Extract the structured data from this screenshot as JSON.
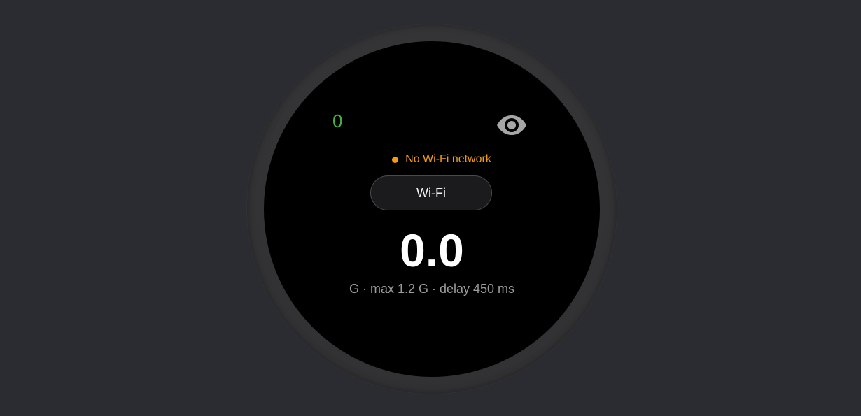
{
  "screen": {
    "counter_value": "0",
    "visibility_icon": "eye-icon",
    "network_status": {
      "text": "No Wi-Fi network",
      "indicator_color": "#f39c12"
    },
    "connection_button_label": "Wi-Fi",
    "speed_value": "0.0",
    "details_text": "G · max 1.2 G · delay 450 ms"
  },
  "colors": {
    "background": "#2b2c31",
    "bezel": "#333335",
    "screen": "#000000",
    "counter": "#43b047",
    "status": "#f39c12",
    "primary_text": "#ffffff",
    "secondary_text": "#9c9c9c",
    "icon": "#a6a6a6"
  }
}
